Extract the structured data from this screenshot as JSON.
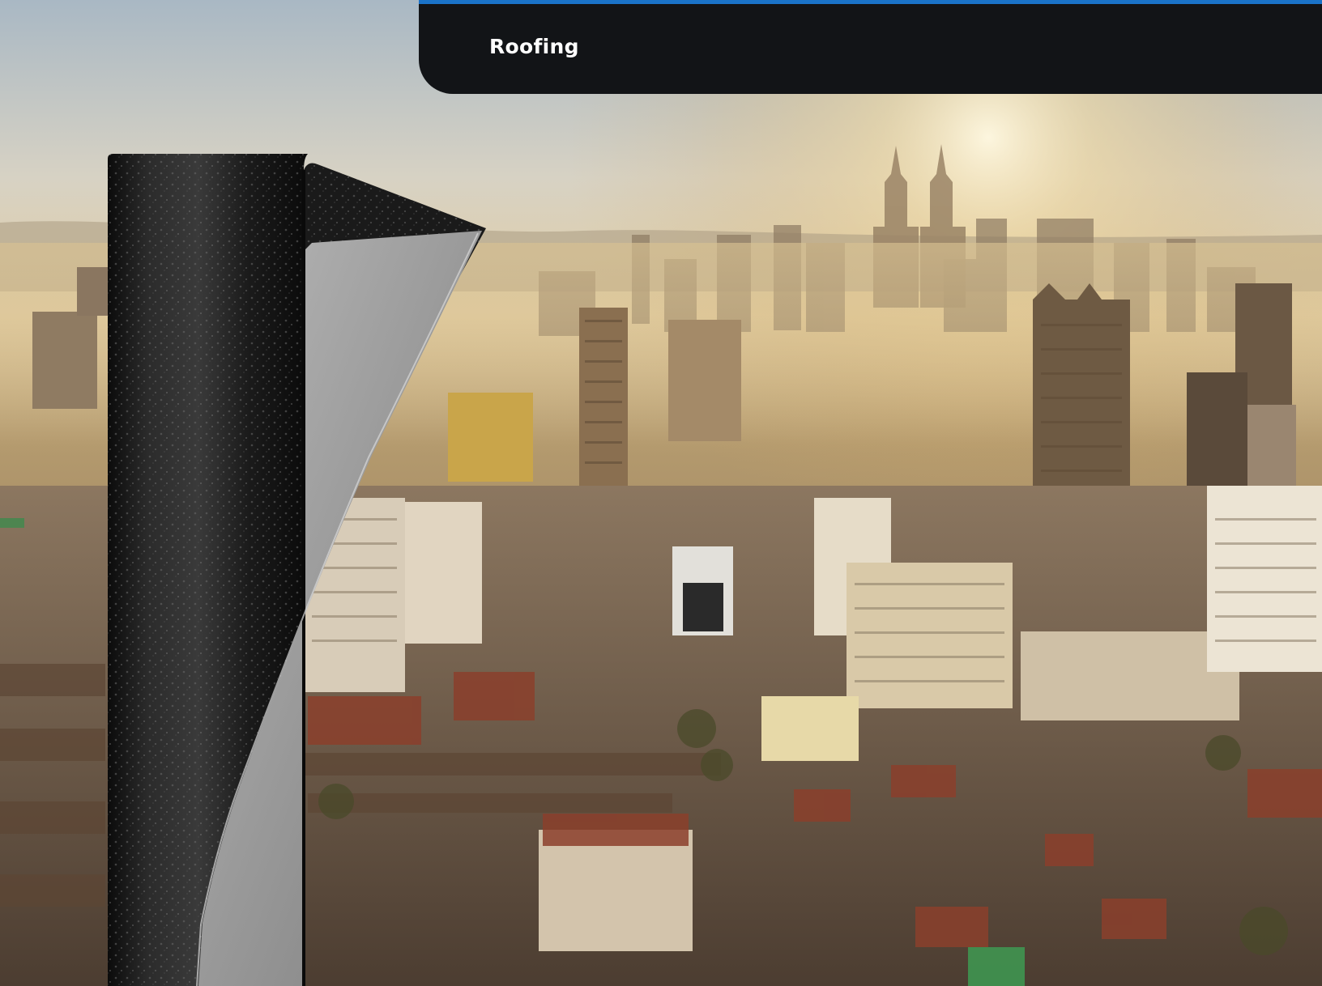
{
  "header": {
    "title": "Roofing",
    "background_color": "#121417",
    "accent_color": "#1a73c9"
  },
  "hero": {
    "scene": "city-skyline-sunrise-photo",
    "product": "roofing-membrane-roll"
  }
}
